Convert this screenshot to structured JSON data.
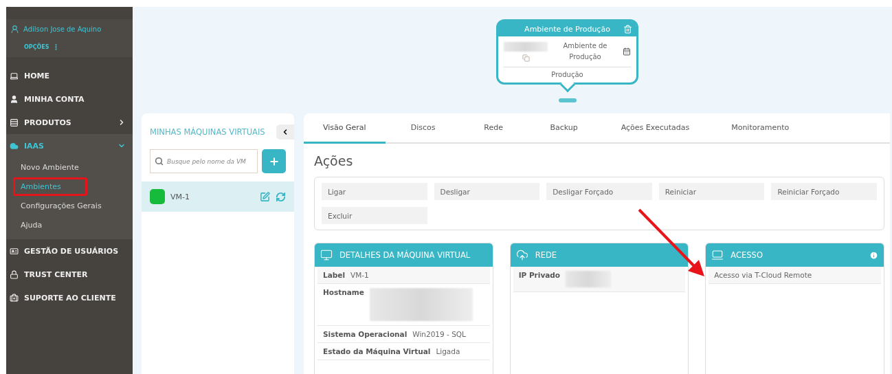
{
  "sidebar": {
    "user": "Adilson Jose de Aquino",
    "options": "OPÇÕES",
    "items": [
      {
        "label": "HOME",
        "kind": "link"
      },
      {
        "label": "MINHA CONTA",
        "kind": "link"
      },
      {
        "label": "PRODUTOS",
        "kind": "menu",
        "expanded": false
      },
      {
        "label": "IAAS",
        "kind": "menu",
        "expanded": true,
        "children": [
          {
            "label": "Novo Ambiente",
            "selected": false,
            "highlighted": false
          },
          {
            "label": "Ambientes",
            "selected": true,
            "highlighted": true
          },
          {
            "label": "Configurações Gerais",
            "selected": false,
            "highlighted": false
          },
          {
            "label": "Ajuda",
            "selected": false,
            "highlighted": false
          }
        ]
      },
      {
        "label": "GESTÃO DE USUÁRIOS",
        "kind": "link"
      },
      {
        "label": "TRUST CENTER",
        "kind": "link"
      },
      {
        "label": "SUPORTE AO CLIENTE",
        "kind": "link"
      }
    ]
  },
  "environment": {
    "title": "Ambiente de Produção",
    "name": "Ambiente de Produção",
    "footer": "Produção"
  },
  "vm_panel": {
    "title": "MINHAS MÁQUINAS VIRTUAIS",
    "search": {
      "placeholder": "Busque pelo nome da VM"
    },
    "vms": [
      {
        "name": "VM-1",
        "color": "#16bb3c",
        "selected": true
      }
    ]
  },
  "tabs": [
    {
      "label": "Visão Geral",
      "selected": true
    },
    {
      "label": "Discos",
      "selected": false
    },
    {
      "label": "Rede",
      "selected": false
    },
    {
      "label": "Backup",
      "selected": false
    },
    {
      "label": "Ações Executadas",
      "selected": false
    },
    {
      "label": "Monitoramento",
      "selected": false
    }
  ],
  "actions": {
    "title": "Ações",
    "buttons": [
      "Ligar",
      "Desligar",
      "Desligar Forçado",
      "Reiniciar",
      "Reiniciar Forçado",
      "Excluir"
    ]
  },
  "cards": [
    {
      "title": "DETALHES DA MÁQUINA VIRTUAL",
      "info": false,
      "rows": [
        {
          "label": "Label",
          "value": "VM-1"
        },
        {
          "label": "Hostname"
        },
        {
          "label": "Sistema Operacional",
          "value": "Win2019 - SQL"
        },
        {
          "label": "Estado da Máquina Virtual",
          "value": "Ligada"
        }
      ]
    },
    {
      "title": "REDE",
      "info": false,
      "rows": [
        {
          "label": "IP Privado"
        }
      ]
    },
    {
      "title": "ACESSO",
      "info": true,
      "rows": [
        {
          "value": "Acesso via T-Cloud Remote"
        }
      ]
    }
  ]
}
